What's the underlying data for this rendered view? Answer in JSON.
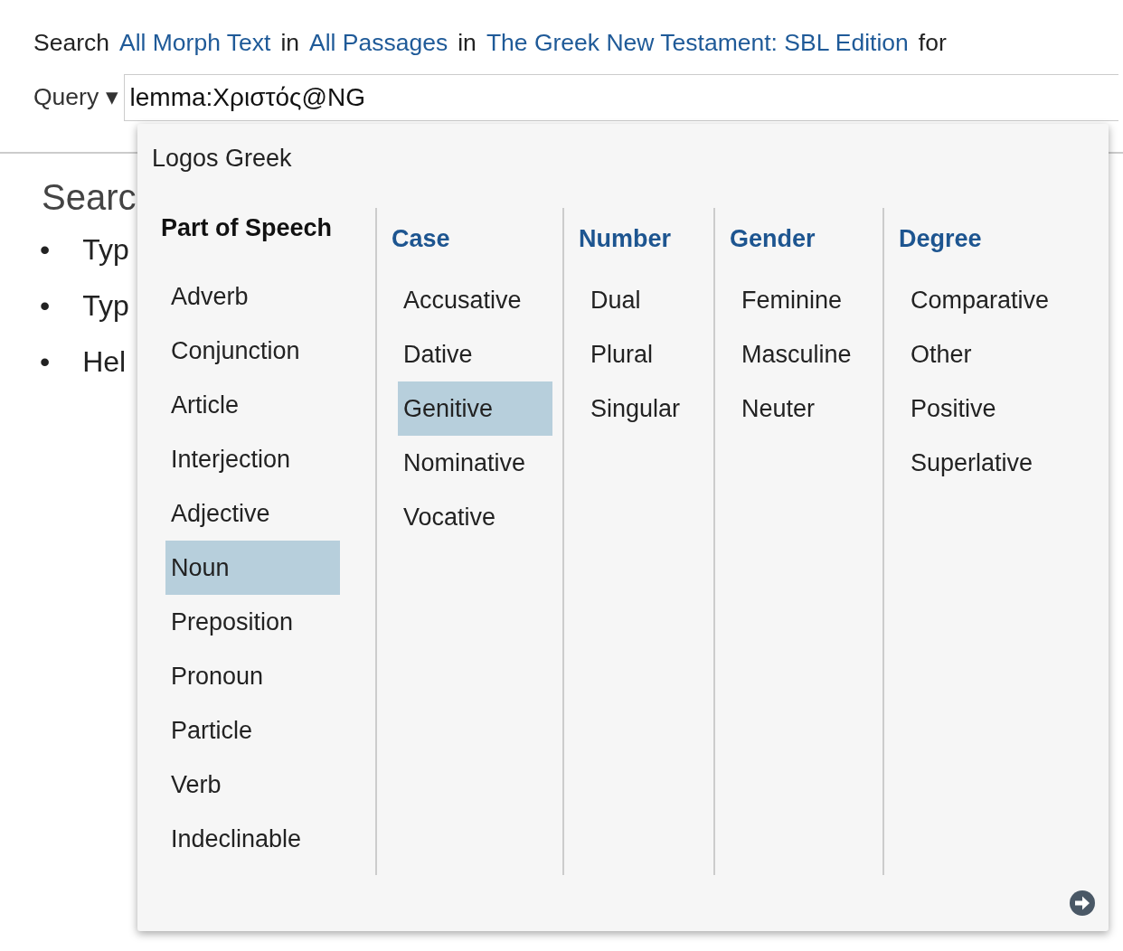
{
  "search_line": {
    "words": [
      {
        "kind": "text",
        "text": "Search"
      },
      {
        "kind": "link",
        "text": "All Morph Text"
      },
      {
        "kind": "text",
        "text": "in"
      },
      {
        "kind": "link",
        "text": "All Passages"
      },
      {
        "kind": "text",
        "text": "in"
      },
      {
        "kind": "link",
        "text": "The Greek New Testament: SBL Edition"
      },
      {
        "kind": "text",
        "text": "for"
      }
    ]
  },
  "query": {
    "label": "Query",
    "caret": "▾",
    "value": "lemma:Χριστός@NG"
  },
  "background": {
    "heading": "Searc",
    "bullets": [
      {
        "bullet": "•",
        "text": "Typ"
      },
      {
        "bullet": "•",
        "text": "Typ"
      },
      {
        "bullet": "•",
        "text": "Hel"
      }
    ]
  },
  "menu": {
    "title": "Logos Greek",
    "columns": [
      {
        "heading": "Part of Speech",
        "kind": "category",
        "items": [
          {
            "label": "Adverb",
            "selected": false
          },
          {
            "label": "Conjunction",
            "selected": false
          },
          {
            "label": "Article",
            "selected": false
          },
          {
            "label": "Interjection",
            "selected": false
          },
          {
            "label": "Adjective",
            "selected": false
          },
          {
            "label": "Noun",
            "selected": true
          },
          {
            "label": "Preposition",
            "selected": false
          },
          {
            "label": "Pronoun",
            "selected": false
          },
          {
            "label": "Particle",
            "selected": false
          },
          {
            "label": "Verb",
            "selected": false
          },
          {
            "label": "Indeclinable",
            "selected": false
          }
        ]
      },
      {
        "heading": "Case",
        "kind": "facet",
        "items": [
          {
            "label": "Accusative",
            "selected": false
          },
          {
            "label": "Dative",
            "selected": false
          },
          {
            "label": "Genitive",
            "selected": true
          },
          {
            "label": "Nominative",
            "selected": false
          },
          {
            "label": "Vocative",
            "selected": false
          }
        ]
      },
      {
        "heading": "Number",
        "kind": "facet",
        "items": [
          {
            "label": "Dual",
            "selected": false
          },
          {
            "label": "Plural",
            "selected": false
          },
          {
            "label": "Singular",
            "selected": false
          }
        ]
      },
      {
        "heading": "Gender",
        "kind": "facet",
        "items": [
          {
            "label": "Feminine",
            "selected": false
          },
          {
            "label": "Masculine",
            "selected": false
          },
          {
            "label": "Neuter",
            "selected": false
          }
        ]
      },
      {
        "heading": "Degree",
        "kind": "facet",
        "items": [
          {
            "label": "Comparative",
            "selected": false
          },
          {
            "label": "Other",
            "selected": false
          },
          {
            "label": "Positive",
            "selected": false
          },
          {
            "label": "Superlative",
            "selected": false
          }
        ]
      }
    ]
  }
}
